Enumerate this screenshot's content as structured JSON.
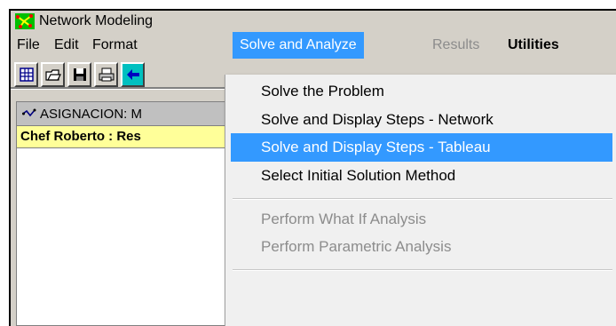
{
  "window": {
    "title": "Network Modeling"
  },
  "menubar": {
    "file": "File",
    "edit": "Edit",
    "format": "Format",
    "solve": "Solve and Analyze",
    "results": "Results",
    "utilities": "Utilities"
  },
  "toolbar": {
    "icons": [
      "new-table-icon",
      "open-folder-icon",
      "save-disk-icon",
      "print-icon",
      "arrow-icon"
    ]
  },
  "child_window": {
    "title": "ASIGNACION: M",
    "subtitle": "Chef Roberto : Res"
  },
  "dropdown": {
    "items": [
      {
        "label": "Solve the Problem",
        "enabled": true
      },
      {
        "label": "Solve and Display Steps - Network",
        "enabled": true
      },
      {
        "label": "Solve and Display Steps - Tableau",
        "enabled": true,
        "highlighted": true
      },
      {
        "label": "Select Initial Solution Method",
        "enabled": true
      },
      {
        "label": "Perform What If Analysis",
        "enabled": false
      },
      {
        "label": "Perform Parametric Analysis",
        "enabled": false
      }
    ]
  },
  "colors": {
    "highlight": "#3399ff",
    "frame": "#d4d0c8",
    "subtitle_bg": "#ffff99"
  }
}
